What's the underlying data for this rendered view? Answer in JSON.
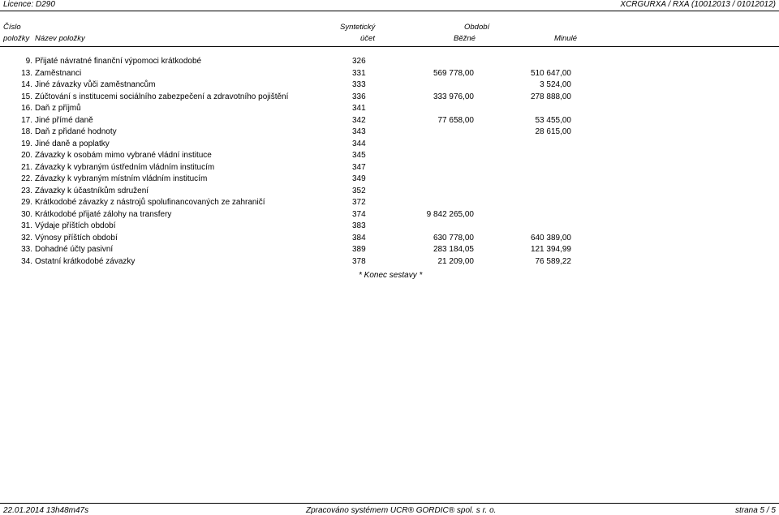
{
  "header_bar": {
    "licence": "Licence: D290",
    "report_code": "XCRGURXA / RXA  (10012013 / 01012012)"
  },
  "columns": {
    "number_top": "Číslo",
    "number_bottom": "položky",
    "name": "Název položky",
    "account_top": "Syntetický",
    "account_bottom": "účet",
    "period": "Období",
    "current": "Běžné",
    "previous": "Minulé"
  },
  "rows": [
    {
      "num": "9.",
      "name": "Přijaté návratné finanční výpomoci krátkodobé",
      "account": "326",
      "current": "",
      "previous": ""
    },
    {
      "num": "13.",
      "name": "Zaměstnanci",
      "account": "331",
      "current": "569 778,00",
      "previous": "510 647,00"
    },
    {
      "num": "14.",
      "name": "Jiné závazky vůči zaměstnancům",
      "account": "333",
      "current": "",
      "previous": "3 524,00"
    },
    {
      "num": "15.",
      "name": "Zúčtování s institucemi sociálního zabezpečení a zdravotního pojištění",
      "account": "336",
      "current": "333 976,00",
      "previous": "278 888,00"
    },
    {
      "num": "16.",
      "name": "Daň z příjmů",
      "account": "341",
      "current": "",
      "previous": ""
    },
    {
      "num": "17.",
      "name": "Jiné přímé daně",
      "account": "342",
      "current": "77 658,00",
      "previous": "53 455,00"
    },
    {
      "num": "18.",
      "name": "Daň z přidané hodnoty",
      "account": "343",
      "current": "",
      "previous": "28 615,00"
    },
    {
      "num": "19.",
      "name": "Jiné daně a poplatky",
      "account": "344",
      "current": "",
      "previous": ""
    },
    {
      "num": "20.",
      "name": "Závazky k osobám mimo vybrané vládní instituce",
      "account": "345",
      "current": "",
      "previous": ""
    },
    {
      "num": "21.",
      "name": "Závazky k vybraným ústředním vládním institucím",
      "account": "347",
      "current": "",
      "previous": ""
    },
    {
      "num": "22.",
      "name": "Závazky k vybraným místním vládním institucím",
      "account": "349",
      "current": "",
      "previous": ""
    },
    {
      "num": "23.",
      "name": "Závazky k účastníkům sdružení",
      "account": "352",
      "current": "",
      "previous": ""
    },
    {
      "num": "29.",
      "name": "Krátkodobé závazky z nástrojů spolufinancovaných ze zahraničí",
      "account": "372",
      "current": "",
      "previous": ""
    },
    {
      "num": "30.",
      "name": "Krátkodobé přijaté zálohy na transfery",
      "account": "374",
      "current": "9 842 265,00",
      "previous": ""
    },
    {
      "num": "31.",
      "name": "Výdaje příštích období",
      "account": "383",
      "current": "",
      "previous": ""
    },
    {
      "num": "32.",
      "name": "Výnosy příštích období",
      "account": "384",
      "current": "630 778,00",
      "previous": "640 389,00"
    },
    {
      "num": "33.",
      "name": "Dohadné účty pasivní",
      "account": "389",
      "current": "283 184,05",
      "previous": "121 394,99"
    },
    {
      "num": "34.",
      "name": "Ostatní krátkodobé závazky",
      "account": "378",
      "current": "21 209,00",
      "previous": "76 589,22"
    }
  ],
  "end_note": "* Konec sestavy *",
  "footer": {
    "timestamp": "22.01.2014 13h48m47s",
    "processed_by": "Zpracováno systémem UCR® GORDIC® spol. s  r. o.",
    "page": "strana 5 / 5"
  }
}
